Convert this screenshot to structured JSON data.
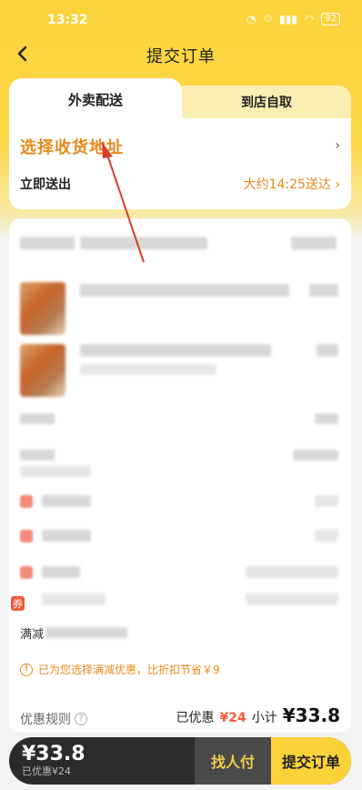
{
  "status": {
    "time": "13:32",
    "battery": "92"
  },
  "nav": {
    "title": "提交订单"
  },
  "tabs": [
    {
      "label": "外卖配送",
      "active": true
    },
    {
      "label": "到店自取",
      "active": false
    }
  ],
  "address": {
    "select_label": "选择收货地址",
    "deliver_label": "立即送出",
    "deliver_time": "大约14:25送达"
  },
  "order": {
    "coupon_tag": "券",
    "manjian_label": "满减",
    "tip": "已为您选择满减优惠，比折扣节省￥9"
  },
  "summary": {
    "rules_label": "优惠规则",
    "discount_label": "已优惠",
    "discount_value": "¥24",
    "subtotal_label": "小计",
    "subtotal_value": "¥33.8"
  },
  "bottom": {
    "price": "¥33.8",
    "saved": "已优惠¥24",
    "friend_pay": "找人付",
    "submit": "提交订单"
  },
  "colors": {
    "brand_yellow": "#fcd23b",
    "accent_orange": "#e8891a",
    "discount_red": "#f25a3a"
  }
}
